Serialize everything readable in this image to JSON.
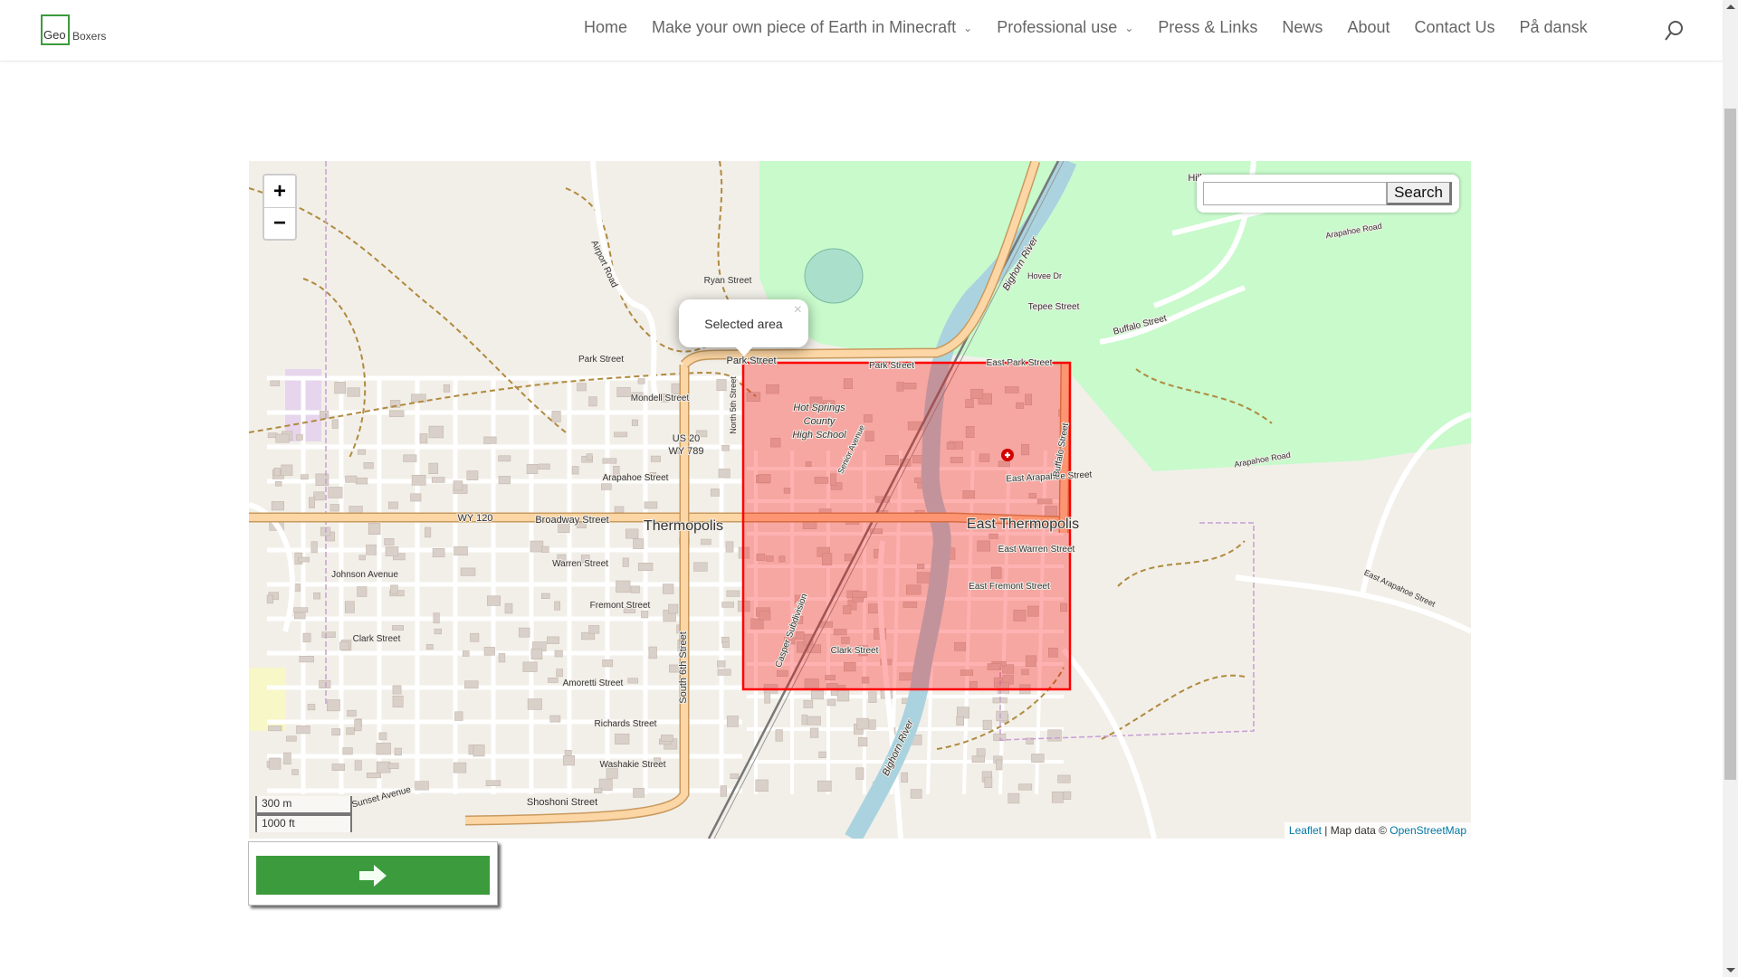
{
  "header": {
    "logo": {
      "part1": "Geo",
      "part2": "Boxers"
    },
    "nav": [
      {
        "label": "Home",
        "dropdown": false
      },
      {
        "label": "Make your own piece of Earth in Minecraft",
        "dropdown": true
      },
      {
        "label": "Professional use",
        "dropdown": true
      },
      {
        "label": "Press & Links",
        "dropdown": false
      },
      {
        "label": "News",
        "dropdown": false
      },
      {
        "label": "About",
        "dropdown": false
      },
      {
        "label": "Contact Us",
        "dropdown": false
      },
      {
        "label": "På dansk",
        "dropdown": false
      }
    ],
    "search_icon": "search-icon"
  },
  "map": {
    "zoom_in": "+",
    "zoom_out": "−",
    "search": {
      "value": "",
      "button": "Search"
    },
    "popup": {
      "text": "Selected area",
      "close": "×"
    },
    "scale": {
      "metric": "300 m",
      "imperial": "1000 ft"
    },
    "attribution": {
      "leaflet": "Leaflet",
      "sep": " | Map data © ",
      "osm": "OpenStreetMap"
    },
    "selection_color": "#ff0000",
    "labels": [
      "Ryan Street",
      "Park Street",
      "Park Street",
      "Park Street",
      "East Park Street",
      "Mondell Street",
      "Hot Springs",
      "County",
      "High School",
      "US 20",
      "WY 789",
      "Arapahoe Street",
      "East Arapahoe Street",
      "WY 120",
      "Broadway Street",
      "Thermopolis",
      "East Thermopolis",
      "East Warren Street",
      "Warren Street",
      "Johnson Avenue",
      "East Fremont Street",
      "Fremont Street",
      "Clark Street",
      "Clark Street",
      "Amoretti Street",
      "Richards Street",
      "Washakie Street",
      "Shoshoni Street",
      "Sunset Avenue",
      "Tepee Street",
      "Hovee Dr",
      "Buffalo Street",
      "Arapahoe Road",
      "Arapahoe Road",
      "East Arapahoe Street",
      "Buffalo Street",
      "Bighorn River",
      "Bighorn River",
      "Airport Road",
      "Hill",
      "South 6th Street",
      "North 5th Street",
      "Senior Avenue",
      "Casper Subdivision"
    ]
  },
  "go_button": {
    "icon": "arrow-right-icon",
    "color": "#3c9b3c"
  }
}
